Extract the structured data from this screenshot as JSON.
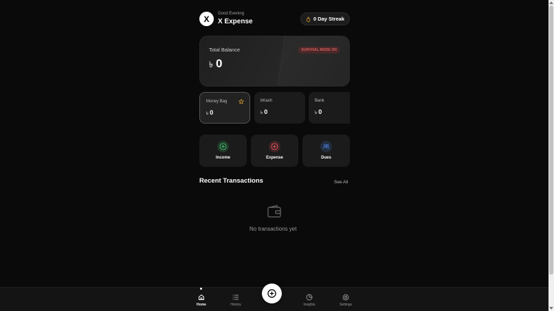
{
  "header": {
    "logo": "X",
    "greeting": "Good Evening",
    "app_name": "X Expense",
    "streak": "0 Day Streak"
  },
  "balance": {
    "label": "Total Balance",
    "currency": "৳",
    "value": "0",
    "mode_badge": "SURVIVAL MODE ON"
  },
  "accounts": [
    {
      "name": "Money Bag",
      "currency": "৳",
      "value": "0",
      "starred": true
    },
    {
      "name": "bKash",
      "currency": "৳",
      "value": "0"
    },
    {
      "name": "Bank",
      "currency": "৳",
      "value": "0"
    }
  ],
  "actions": {
    "income": "Income",
    "expense": "Expense",
    "dues": "Dues"
  },
  "recent": {
    "title": "Recent Transactions",
    "see_all": "See All",
    "empty": "No transactions yet"
  },
  "nav": {
    "home": "Home",
    "history": "History",
    "insights": "Insights",
    "settings": "Settings"
  },
  "colors": {
    "income": "#3fbf6a",
    "expense": "#e0505a",
    "dues": "#4a7fe0",
    "badge": "#d96060",
    "star": "#e0a030"
  }
}
